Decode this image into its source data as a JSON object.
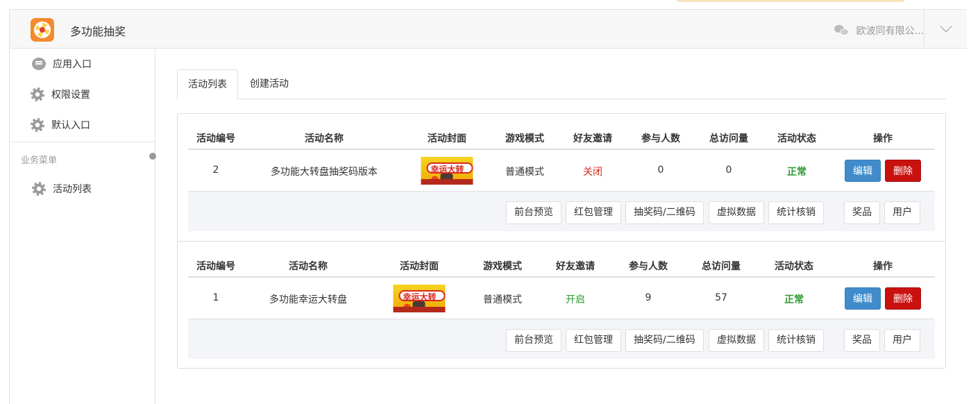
{
  "header": {
    "app_title": "多功能抽奖",
    "company": "欧波同有限公...",
    "colors": {
      "logo": "#f28a2e",
      "header_bg": "#f7f7f7"
    }
  },
  "sidebar": {
    "items": [
      {
        "label": "应用入口",
        "icon": "chat-icon"
      },
      {
        "label": "权限设置",
        "icon": "gear-icon"
      },
      {
        "label": "默认入口",
        "icon": "gear-icon"
      }
    ],
    "group_label": "业务菜单",
    "group_items": [
      {
        "label": "活动列表",
        "icon": "gear-icon"
      }
    ]
  },
  "tabs": [
    {
      "label": "活动列表",
      "active": true
    },
    {
      "label": "创建活动",
      "active": false
    }
  ],
  "activities": [
    {
      "headers": [
        "活动编号",
        "活动名称",
        "活动封面",
        "游戏模式",
        "好友邀请",
        "参与人数",
        "总访问量",
        "活动状态",
        "操作"
      ],
      "id": "2",
      "name": "多功能大转盘抽奖码版本",
      "cover_text": "幸运大转盘",
      "mode": "普通模式",
      "invite": "关闭",
      "participants": "0",
      "visits": "0",
      "status": "正常",
      "edit": "编辑",
      "delete": "删除",
      "actions": [
        "前台预览",
        "红包管理",
        "抽奖码/二维码",
        "虚拟数据",
        "统计核销"
      ],
      "actions_right": [
        "奖品",
        "用户"
      ]
    },
    {
      "headers": [
        "活动编号",
        "活动名称",
        "活动封面",
        "游戏模式",
        "好友邀请",
        "参与人数",
        "总访问量",
        "活动状态",
        "操作"
      ],
      "id": "1",
      "name": "多功能幸运大转盘",
      "cover_text": "幸运大转盘",
      "mode": "普通模式",
      "invite": "开启",
      "participants": "9",
      "visits": "57",
      "status": "正常",
      "edit": "编辑",
      "delete": "删除",
      "actions": [
        "前台预览",
        "红包管理",
        "抽奖码/二维码",
        "虚拟数据",
        "统计核销"
      ],
      "actions_right": [
        "奖品",
        "用户"
      ]
    }
  ],
  "colors": {
    "edit_button": "#428bca",
    "delete_button": "#c9120f",
    "status_ok": "#2e9a2e",
    "invite_off": "#d9261c",
    "invite_on": "#2e9a2e"
  }
}
